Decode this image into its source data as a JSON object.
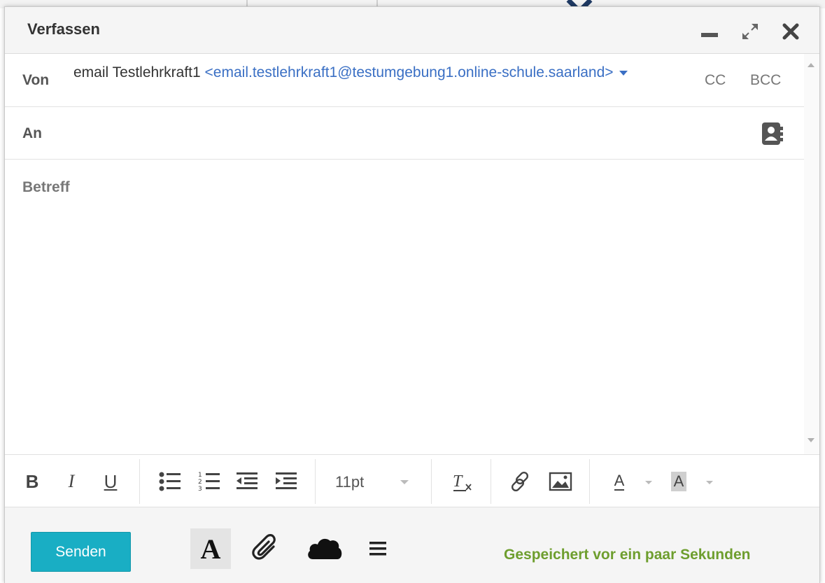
{
  "window": {
    "title": "Verfassen"
  },
  "from": {
    "label": "Von",
    "sender_name": "email Testlehrkraft1",
    "sender_address": "<email.testlehrkraft1@testumgebung1.online-schule.saarland>",
    "cc_label": "CC",
    "bcc_label": "BCC"
  },
  "to": {
    "label": "An"
  },
  "subject": {
    "label": "Betreff"
  },
  "toolbar": {
    "bold": "B",
    "italic": "I",
    "underline": "U",
    "font_size": "11pt",
    "text_color_glyph": "A",
    "highlight_glyph": "A"
  },
  "footer": {
    "send_label": "Senden",
    "font_button_glyph": "A",
    "status_text": "Gespeichert vor ein paar Sekunden"
  },
  "colors": {
    "accent": "#19aec4",
    "link": "#3a6fc4",
    "status": "#6e9e2e"
  },
  "icons": [
    "minimize-icon",
    "maximize-icon",
    "close-icon",
    "address-book-icon",
    "bullet-list-icon",
    "numbered-list-icon",
    "outdent-icon",
    "indent-icon",
    "clear-formatting-icon",
    "link-icon",
    "image-icon",
    "paperclip-icon",
    "cloud-icon",
    "menu-icon"
  ]
}
